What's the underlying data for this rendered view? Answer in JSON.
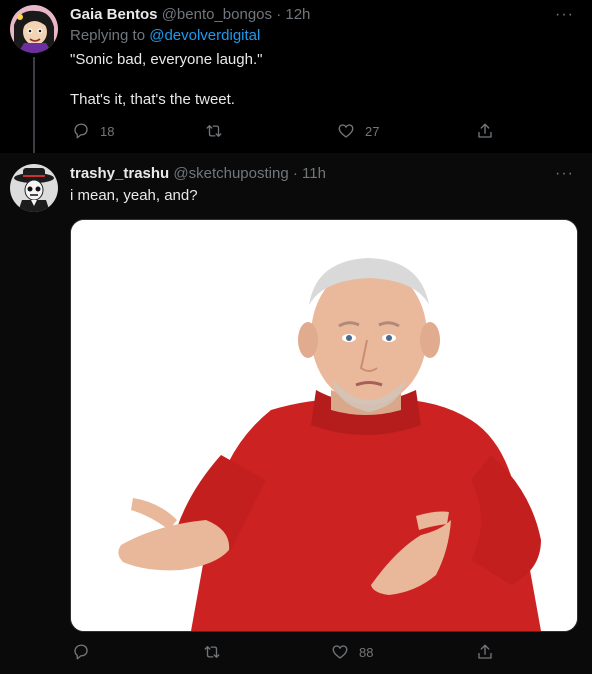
{
  "tweet1": {
    "name": "Gaia Bentos",
    "handle": "@bento_bongos",
    "dot": "·",
    "time": "12h",
    "replying_prefix": "Replying to",
    "replying_mention": "@devolverdigital",
    "text_line1": "\"Sonic bad, everyone laugh.\"",
    "text_line2": "That's it, that's the tweet.",
    "more": "···",
    "reply_count": "18",
    "retweet_count": "",
    "like_count": "27"
  },
  "tweet2": {
    "name": "trashy_trashu",
    "handle": "@sketchuposting",
    "dot": "·",
    "time": "11h",
    "text": "i mean, yeah, and?",
    "more": "···",
    "reply_count": "",
    "retweet_count": "",
    "like_count": "88"
  },
  "icons": {
    "reply": "reply-icon",
    "retweet": "retweet-icon",
    "like": "heart-icon",
    "share": "share-icon",
    "more": "more-icon"
  },
  "colors": {
    "background": "#000000",
    "text": "#e7e9ea",
    "muted": "#71767b",
    "link": "#1d9bf0",
    "shirt": "#cc2222"
  }
}
